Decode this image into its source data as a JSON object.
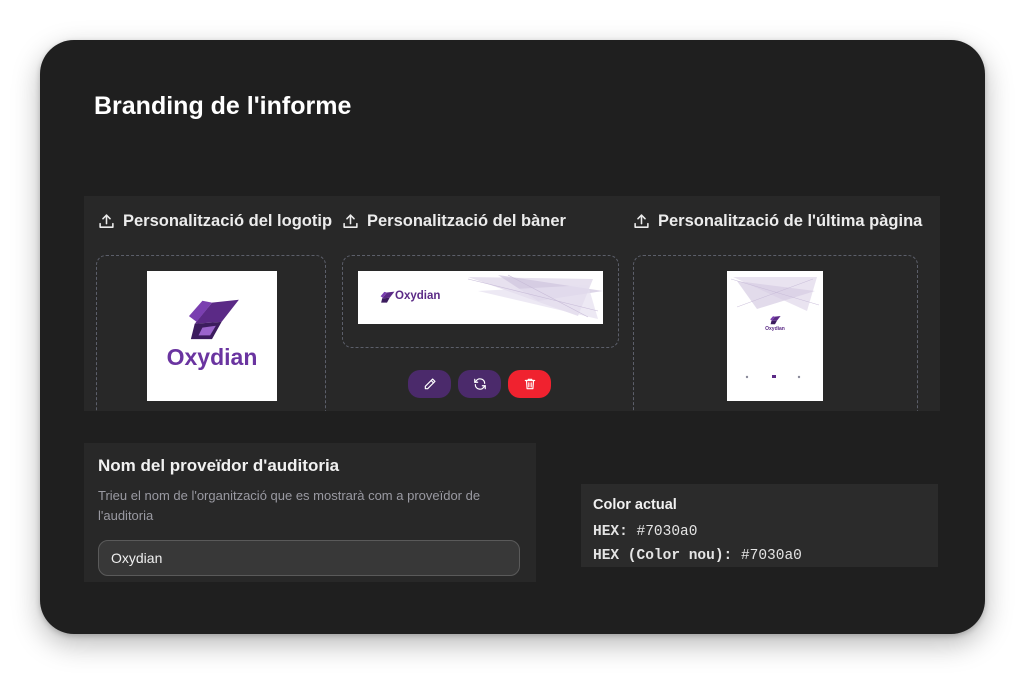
{
  "page": {
    "title": "Branding de l'informe"
  },
  "upload": {
    "logo": {
      "header": "Personalització del logotip",
      "brand_text": "Oxydian"
    },
    "banner": {
      "header": "Personalització del bàner",
      "brand_text": "Oxydian"
    },
    "last_page": {
      "header": "Personalització de l'última pàgina",
      "brand_text": "Oxydian"
    },
    "actions": [
      {
        "name": "edit",
        "icon": "pencil-icon",
        "color": "#4b2a6b"
      },
      {
        "name": "replace",
        "icon": "refresh-icon",
        "color": "#4b2a6b"
      },
      {
        "name": "delete",
        "icon": "trash-icon",
        "color": "#f0222f"
      }
    ]
  },
  "provider": {
    "title": "Nom del proveïdor d'auditoria",
    "description": "Trieu el nom de l'organització que es mostrarà com a proveïdor de l'auditoria",
    "value": "Oxydian"
  },
  "color": {
    "title": "Color actual",
    "hex_label": "HEX:",
    "hex_value": "#7030a0",
    "new_label": "HEX (Color nou):",
    "new_value": "#7030a0"
  }
}
